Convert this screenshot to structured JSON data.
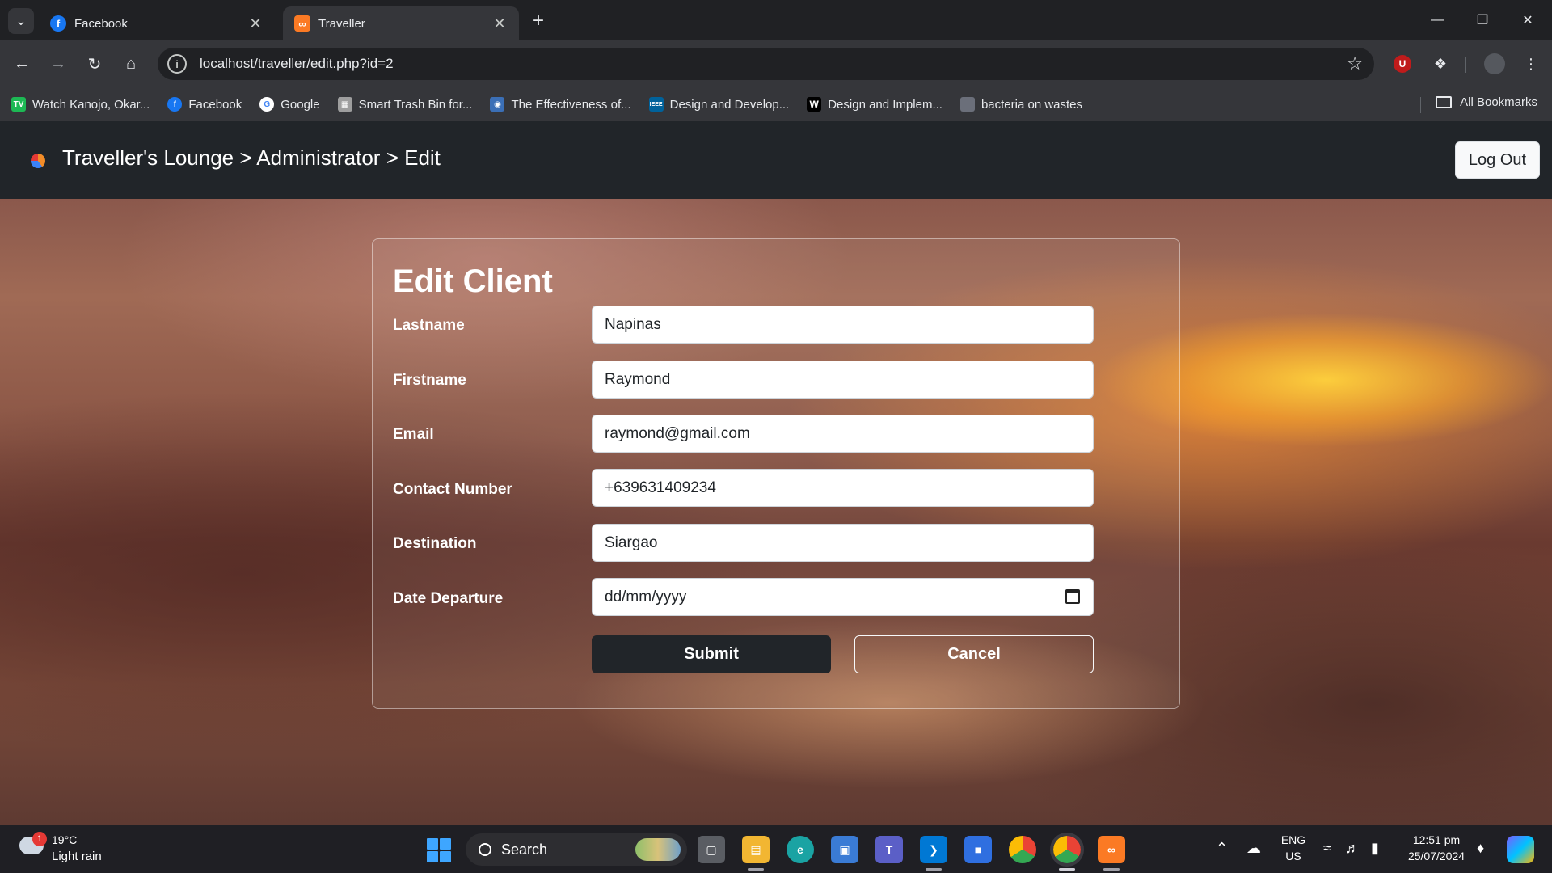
{
  "browser": {
    "tabs": [
      {
        "title": "Facebook",
        "active": false
      },
      {
        "title": "Traveller",
        "active": true
      }
    ],
    "url": "localhost/traveller/edit.php?id=2",
    "bookmarks": [
      {
        "label": "Watch Kanojo, Okar...",
        "icon": "tv-icon",
        "color": "#1db954"
      },
      {
        "label": "Facebook",
        "icon": "facebook-icon",
        "color": "#1877f2"
      },
      {
        "label": "Google",
        "icon": "google-icon",
        "color": "#ffffff"
      },
      {
        "label": "Smart Trash Bin for...",
        "icon": "document-icon",
        "color": "#9e9e9e"
      },
      {
        "label": "The Effectiveness of...",
        "icon": "globe-icon",
        "color": "#3b6fb6"
      },
      {
        "label": "Design and Develop...",
        "icon": "ieee-icon",
        "color": "#00629b"
      },
      {
        "label": "Design and Implem...",
        "icon": "w-icon",
        "color": "#000000"
      },
      {
        "label": "bacteria on wastes",
        "icon": "page-icon",
        "color": "#6b6f7a"
      }
    ],
    "all_bookmarks": "All Bookmarks"
  },
  "navbar": {
    "breadcrumb": "Traveller's Lounge > Administrator > Edit",
    "logout_label": "Log Out"
  },
  "form": {
    "title": "Edit Client",
    "fields": [
      {
        "label": "Lastname",
        "value": "Napinas"
      },
      {
        "label": "Firstname",
        "value": "Raymond"
      },
      {
        "label": "Email",
        "value": "raymond@gmail.com"
      },
      {
        "label": "Contact Number",
        "value": "+639631409234"
      },
      {
        "label": "Destination",
        "value": "Siargao"
      },
      {
        "label": "Date Departure",
        "value": "dd/mm/yyyy"
      }
    ],
    "submit_label": "Submit",
    "cancel_label": "Cancel"
  },
  "taskbar": {
    "weather_temp": "19°C",
    "weather_desc": "Light rain",
    "weather_badge": "1",
    "search_label": "Search",
    "lang_top": "ENG",
    "lang_bottom": "US",
    "time": "12:51 pm",
    "date": "25/07/2024"
  }
}
